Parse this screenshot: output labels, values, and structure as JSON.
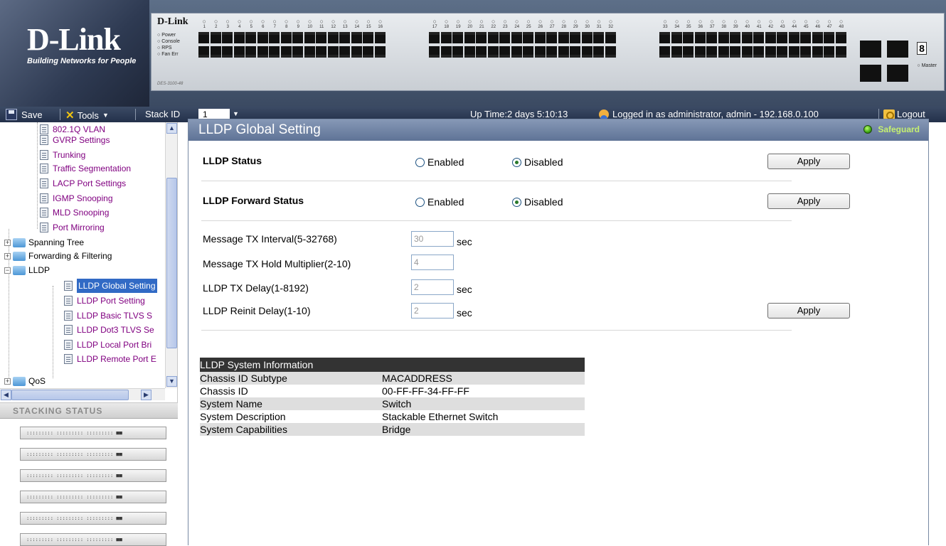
{
  "banner": {
    "brand": "D-Link",
    "tagline": "Building Networks for People",
    "switch_brand": "D-Link",
    "switch_leds": [
      "Power",
      "Console",
      "RPS",
      "Fan Err"
    ],
    "switch_model": "DES-3100-48",
    "port_numbers_g1": [
      "1",
      "2",
      "3",
      "4",
      "5",
      "6",
      "7",
      "8",
      "9",
      "10",
      "11",
      "12",
      "13",
      "14",
      "15",
      "16"
    ],
    "port_numbers_g2": [
      "17",
      "18",
      "19",
      "20",
      "21",
      "22",
      "23",
      "24",
      "25",
      "26",
      "27",
      "28",
      "29",
      "30",
      "31",
      "32"
    ],
    "port_numbers_g3": [
      "33",
      "34",
      "35",
      "36",
      "37",
      "38",
      "39",
      "40",
      "41",
      "42",
      "43",
      "44",
      "45",
      "46",
      "47",
      "48"
    ],
    "seven_segment": "8",
    "master_label": "Master"
  },
  "toolbar": {
    "save_label": "Save",
    "tools_label": "Tools",
    "stack_id_label": "Stack ID",
    "stack_id_value": "1",
    "status_text": "Up Time:2 days 5:10:13",
    "login_text": "Logged in as administrator, admin - 192.168.0.100",
    "logout_label": "Logout"
  },
  "tree": {
    "items": [
      {
        "label": "802.1Q VLAN",
        "type": "doc"
      },
      {
        "label": "GVRP Settings",
        "type": "doc"
      },
      {
        "label": "Trunking",
        "type": "doc"
      },
      {
        "label": "Traffic Segmentation",
        "type": "doc"
      },
      {
        "label": "LACP Port Settings",
        "type": "doc"
      },
      {
        "label": "IGMP Snooping",
        "type": "doc"
      },
      {
        "label": "MLD Snooping",
        "type": "doc"
      },
      {
        "label": "Port Mirroring",
        "type": "doc"
      },
      {
        "label": "Spanning Tree",
        "type": "folder"
      },
      {
        "label": "Forwarding & Filtering",
        "type": "folder"
      },
      {
        "label": "LLDP",
        "type": "folder-open"
      },
      {
        "label": "LLDP Global Setting",
        "type": "doc",
        "selected": true
      },
      {
        "label": "LLDP Port Setting",
        "type": "doc"
      },
      {
        "label": "LLDP Basic TLVS S",
        "type": "doc"
      },
      {
        "label": "LLDP Dot3 TLVS Se",
        "type": "doc"
      },
      {
        "label": "LLDP Local Port Bri",
        "type": "doc"
      },
      {
        "label": "LLDP Remote Port E",
        "type": "doc"
      },
      {
        "label": "QoS",
        "type": "folder"
      }
    ]
  },
  "stacking": {
    "header": "Stacking Status",
    "units": [
      "::::::::: ::::::::: ::::::::: ■■",
      "::::::::: ::::::::: ::::::::: ■■",
      "::::::::: ::::::::: ::::::::: ■■",
      "::::::::: ::::::::: ::::::::: ■■",
      "::::::::: ::::::::: ::::::::: ■■",
      "::::::::: ::::::::: ::::::::: ■■"
    ]
  },
  "main": {
    "title": "LLDP Global Setting",
    "safeguard_label": "Safeguard",
    "lldp_status": {
      "label": "LLDP Status",
      "enabled_label": "Enabled",
      "disabled_label": "Disabled",
      "selected": "Disabled",
      "apply_label": "Apply"
    },
    "lldp_forward_status": {
      "label": "LLDP Forward Status",
      "enabled_label": "Enabled",
      "disabled_label": "Disabled",
      "selected": "Disabled",
      "apply_label": "Apply"
    },
    "params": [
      {
        "label": "Message TX Interval(5-32768)",
        "value": "30",
        "unit": "sec"
      },
      {
        "label": "Message TX Hold Multiplier(2-10)",
        "value": "4",
        "unit": ""
      },
      {
        "label": "LLDP TX Delay(1-8192)",
        "value": "2",
        "unit": "sec"
      },
      {
        "label": "LLDP Reinit Delay(1-10)",
        "value": "2",
        "unit": "sec"
      }
    ],
    "params_apply_label": "Apply",
    "system_info": {
      "header": "LLDP System Information",
      "rows": [
        {
          "key": "Chassis ID Subtype",
          "value": "MACADDRESS"
        },
        {
          "key": "Chassis ID",
          "value": "00-FF-FF-34-FF-FF"
        },
        {
          "key": "System Name",
          "value": "Switch"
        },
        {
          "key": "System Description",
          "value": "Stackable Ethernet Switch"
        },
        {
          "key": "System Capabilities",
          "value": "Bridge"
        }
      ]
    }
  }
}
